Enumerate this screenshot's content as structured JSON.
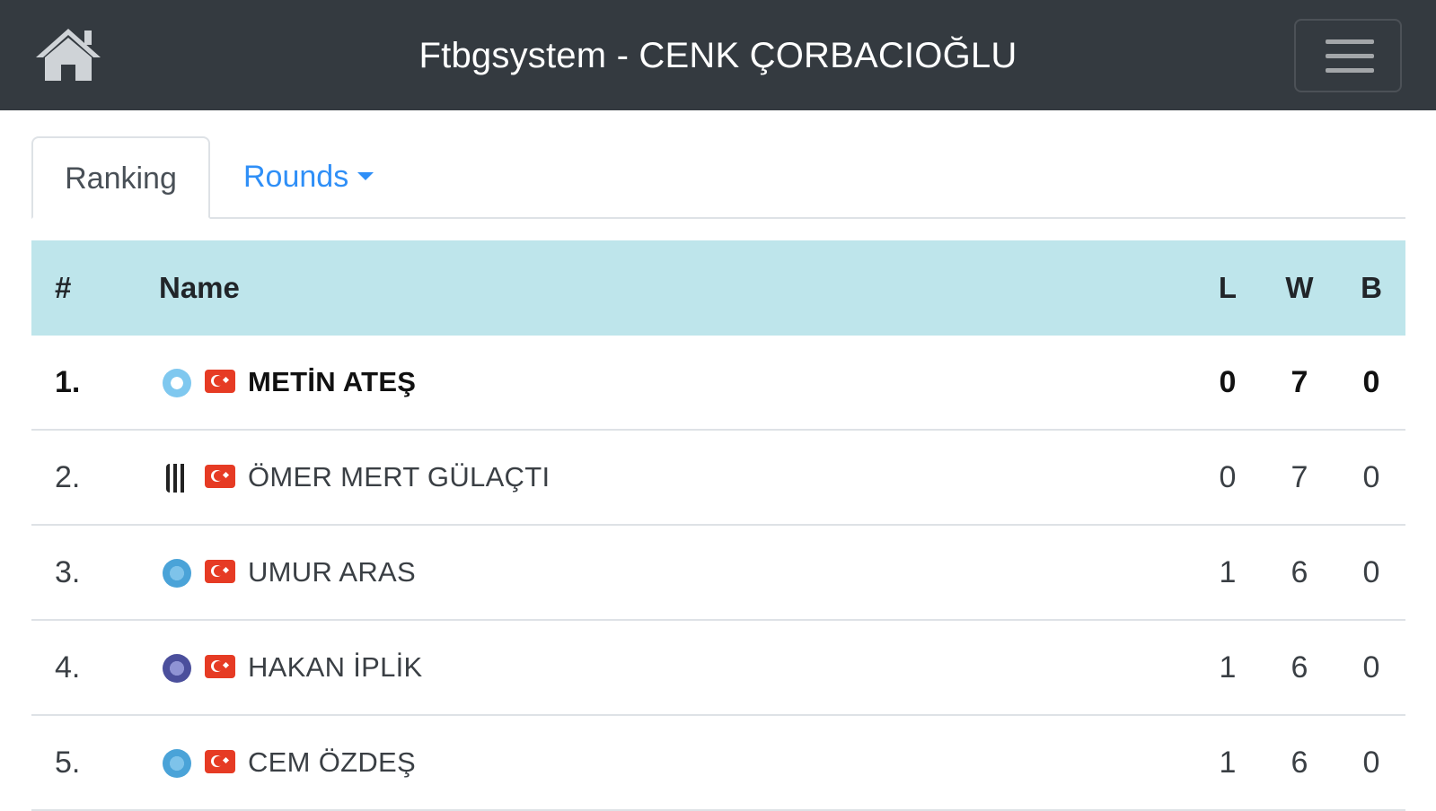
{
  "header": {
    "title": "Ftbgsystem - CENK ÇORBACIOĞLU",
    "home_icon": "home-icon",
    "menu_icon": "hamburger-menu-icon"
  },
  "tabs": {
    "ranking": "Ranking",
    "rounds": "Rounds"
  },
  "table": {
    "headers": {
      "rank": "#",
      "name": "Name",
      "l": "L",
      "w": "W",
      "b": "B"
    },
    "rows": [
      {
        "rank": "1.",
        "name": "METİN ATEŞ",
        "club_icon": "club-badge-icon",
        "club_color": "#7fc8ef",
        "flag": "turkey-flag-icon",
        "l": "0",
        "w": "7",
        "b": "0",
        "highlight": true
      },
      {
        "rank": "2.",
        "name": "ÖMER MERT GÜLAÇTI",
        "club_icon": "besiktas-badge-icon",
        "club_color": "#222222",
        "flag": "turkey-flag-icon",
        "l": "0",
        "w": "7",
        "b": "0",
        "highlight": false
      },
      {
        "rank": "3.",
        "name": "UMUR ARAS",
        "club_icon": "club-badge-icon",
        "club_color": "#4aa3d8",
        "flag": "turkey-flag-icon",
        "l": "1",
        "w": "6",
        "b": "0",
        "highlight": false
      },
      {
        "rank": "4.",
        "name": "HAKAN İPLİK",
        "club_icon": "club-badge-icon",
        "club_color": "#4b4f9c",
        "flag": "turkey-flag-icon",
        "l": "1",
        "w": "6",
        "b": "0",
        "highlight": false
      },
      {
        "rank": "5.",
        "name": "CEM ÖZDEŞ",
        "club_icon": "club-badge-icon",
        "club_color": "#4aa3d8",
        "flag": "turkey-flag-icon",
        "l": "1",
        "w": "6",
        "b": "0",
        "highlight": false
      }
    ]
  },
  "colors": {
    "navbar": "#343a40",
    "table_header": "#bee5eb",
    "link": "#2f8ff7",
    "flag_red": "#e63b24"
  }
}
